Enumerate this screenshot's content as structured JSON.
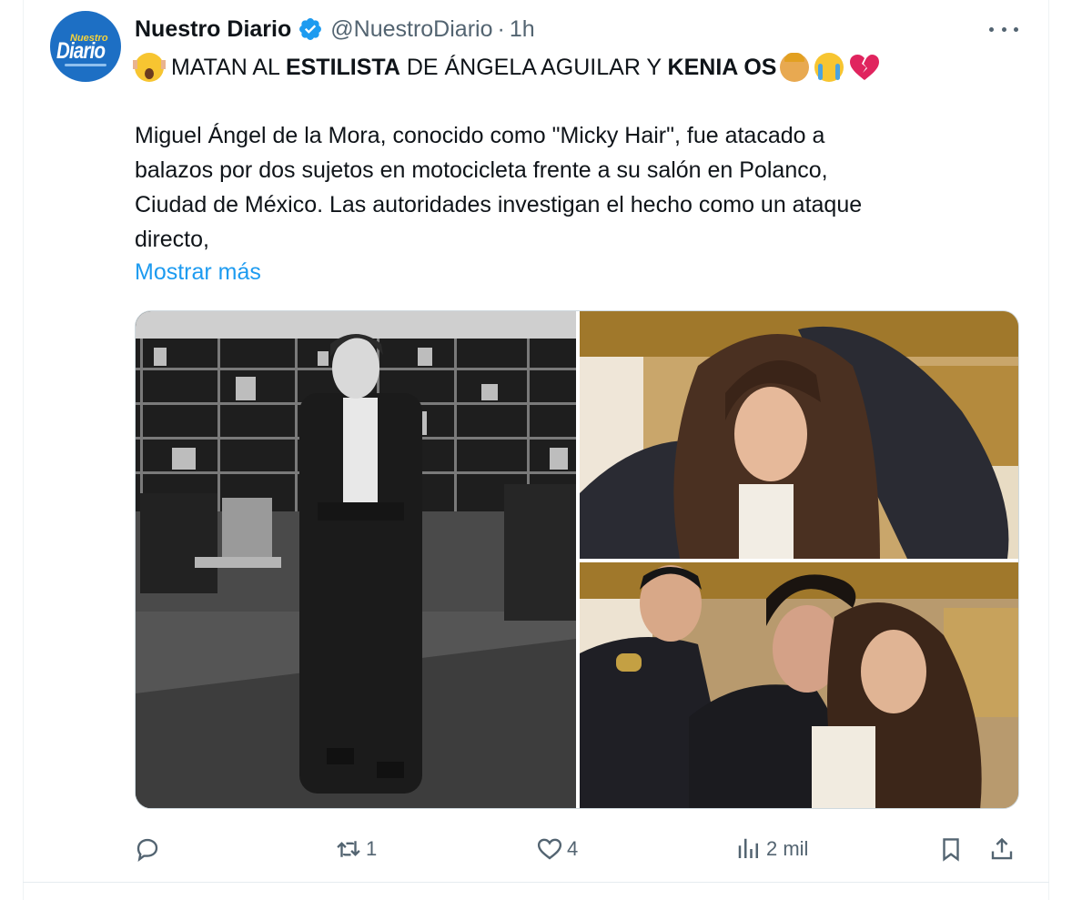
{
  "tweet": {
    "author_name": "Nuestro Diario",
    "handle": "@NuestroDiario",
    "separator": "·",
    "time": "1h",
    "avatar_text": {
      "top": "Nuestro",
      "main": "Diario"
    },
    "headline": {
      "part1": "MATAN AL ",
      "bold1": "ESTILISTA",
      "part2": " DE ÁNGELA AGUILAR Y ",
      "bold2": "KENIA OS"
    },
    "body_lines": [
      "Miguel Ángel de la Mora, conocido como \"Micky Hair\", fue atacado a",
      "balazos por dos sujetos en motocicleta frente a su salón en Polanco,",
      "Ciudad de México. Las autoridades investigan el hecho como un ataque",
      "directo,"
    ],
    "show_more": "Mostrar más",
    "emojis": [
      "face-screaming-in-fear",
      "woman-getting-haircut",
      "loudly-crying-face",
      "broken-heart"
    ],
    "media": [
      {
        "name": "stylist-portrait-photo",
        "description": "photo"
      },
      {
        "name": "woman-long-hair-photo",
        "description": "photo"
      },
      {
        "name": "group-smiling-photo",
        "description": "photo"
      }
    ],
    "actions": {
      "reply_count": "",
      "retweet_count": "1",
      "like_count": "4",
      "views_count": "2 mil"
    },
    "colors": {
      "accent": "#1d9bf0",
      "text": "#0f1419",
      "muted": "#536471",
      "verified": "#1d9bf0",
      "broken_heart": "#e0245e"
    }
  }
}
